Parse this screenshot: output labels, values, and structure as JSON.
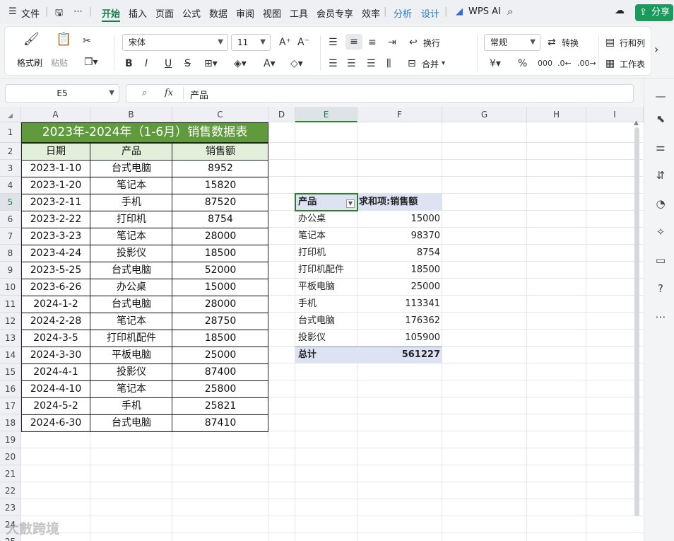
{
  "menubar": {
    "file": "文件",
    "tabs": [
      "开始",
      "插入",
      "页面",
      "公式",
      "数据",
      "审阅",
      "视图",
      "工具",
      "会员专享",
      "效率"
    ],
    "blue_tabs": [
      "分析",
      "设计"
    ],
    "wps_ai": "WPS AI",
    "share": "分享"
  },
  "ribbon": {
    "format_painter": "格式刷",
    "paste": "粘贴",
    "font_name": "宋体",
    "font_size": "11",
    "wrap": "换行",
    "merge": "合并",
    "number_format": "常规",
    "convert": "转换",
    "row_col": "行和列",
    "worksheet": "工作表"
  },
  "formula_bar": {
    "name_box": "E5",
    "fx": "fx",
    "content": "产品"
  },
  "columns": [
    "A",
    "B",
    "C",
    "D",
    "E",
    "F",
    "G",
    "H",
    "I"
  ],
  "rows": [
    "1",
    "2",
    "3",
    "4",
    "5",
    "6",
    "7",
    "8",
    "9",
    "10",
    "11",
    "12",
    "13",
    "14",
    "15",
    "16",
    "17",
    "18",
    "19",
    "20",
    "21",
    "22",
    "23",
    "24",
    "25"
  ],
  "table": {
    "title": "2023年-2024年（1-6月）销售数据表",
    "headers": [
      "日期",
      "产品",
      "销售额"
    ],
    "rows": [
      [
        "2023-1-10",
        "台式电脑",
        "8952"
      ],
      [
        "2023-1-20",
        "笔记本",
        "15820"
      ],
      [
        "2023-2-11",
        "手机",
        "87520"
      ],
      [
        "2023-2-22",
        "打印机",
        "8754"
      ],
      [
        "2023-3-23",
        "笔记本",
        "28000"
      ],
      [
        "2023-4-24",
        "投影仪",
        "18500"
      ],
      [
        "2023-5-25",
        "台式电脑",
        "52000"
      ],
      [
        "2023-6-26",
        "办公桌",
        "15000"
      ],
      [
        "2024-1-2",
        "台式电脑",
        "28000"
      ],
      [
        "2024-2-28",
        "笔记本",
        "28750"
      ],
      [
        "2024-3-5",
        "打印机配件",
        "18500"
      ],
      [
        "2024-3-30",
        "平板电脑",
        "25000"
      ],
      [
        "2024-4-1",
        "投影仪",
        "87400"
      ],
      [
        "2024-4-10",
        "笔记本",
        "25800"
      ],
      [
        "2024-5-2",
        "手机",
        "25821"
      ],
      [
        "2024-6-30",
        "台式电脑",
        "87410"
      ]
    ]
  },
  "pivot": {
    "header_field": "产品",
    "header_value": "求和项:销售额",
    "rows": [
      [
        "办公桌",
        "15000"
      ],
      [
        "笔记本",
        "98370"
      ],
      [
        "打印机",
        "8754"
      ],
      [
        "打印机配件",
        "18500"
      ],
      [
        "平板电脑",
        "25000"
      ],
      [
        "手机",
        "113341"
      ],
      [
        "台式电脑",
        "176362"
      ],
      [
        "投影仪",
        "105900"
      ]
    ],
    "total_label": "总计",
    "total_value": "561227"
  },
  "watermark": "大數跨境",
  "colors": {
    "title_bg": "#5f9a3c",
    "header_bg": "#e2efda",
    "pivot_header_bg": "#dde3f3",
    "accent": "#1a7f4a"
  }
}
